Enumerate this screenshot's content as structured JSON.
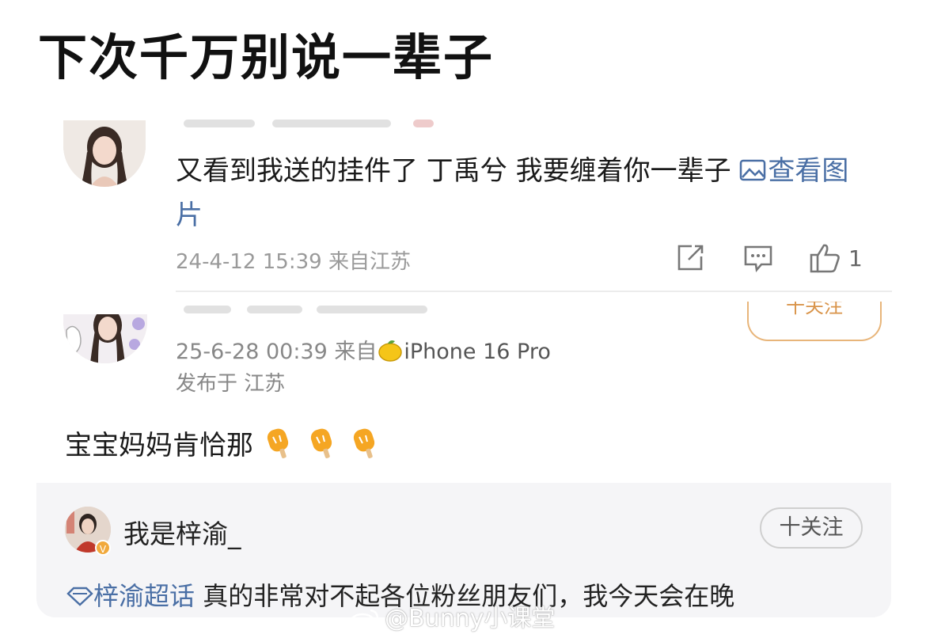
{
  "headline": "下次千万别说一辈子",
  "comment1": {
    "text": "又看到我送的挂件了 丁禹兮 我要缠着你一辈子 ",
    "image_link": "查看图片",
    "timestamp": "24-4-12 15:39",
    "source": "来自江苏",
    "like_count": "1"
  },
  "comment2": {
    "follow_label": "十关注",
    "timestamp": "25-6-28 00:39",
    "from_label": "来自",
    "device": "iPhone 16 Pro",
    "location": "发布于 江苏",
    "body": "宝宝妈妈肯恰那"
  },
  "repost": {
    "username": "我是梓渝_",
    "follow_label": "十关注",
    "topic": "梓渝超话",
    "text": " 真的非常对不起各位粉丝朋友们，我今天会在晚"
  },
  "watermark": "@Bunny小课堂",
  "colors": {
    "link": "#4a6fa5",
    "follow_accent": "#d9944a",
    "badge": "#f1a93c"
  }
}
